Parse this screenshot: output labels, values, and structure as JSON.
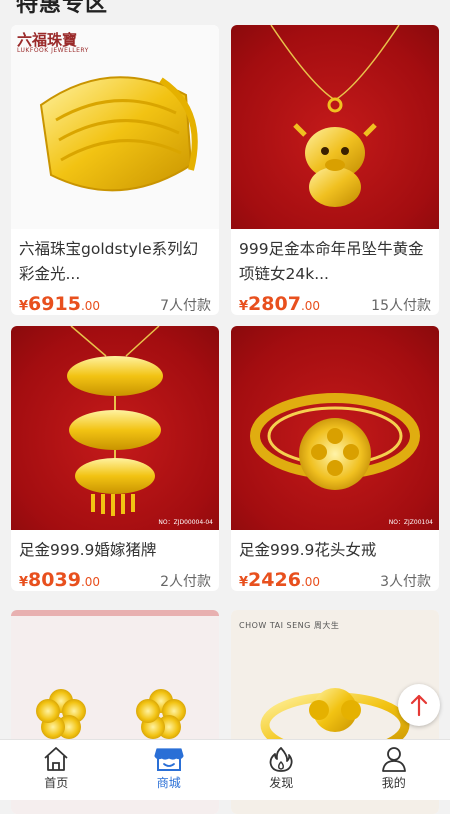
{
  "section": {
    "title": "特惠专区"
  },
  "products": [
    {
      "title": "六福珠宝goldstyle系列幻彩金光...",
      "currency": "¥",
      "price_int": "6915",
      "price_dec": ".00",
      "sold": "7人付款",
      "brand": "六福珠寶",
      "brand_sub": "LUKFOOK JEWELLERY"
    },
    {
      "title": "999足金本命年吊坠牛黄金项链女24k...",
      "currency": "¥",
      "price_int": "2807",
      "price_dec": ".00",
      "sold": "15人付款"
    },
    {
      "title": "足金999.9婚嫁猪牌",
      "currency": "¥",
      "price_int": "8039",
      "price_dec": ".00",
      "sold": "2人付款",
      "code": "NO：ZJD00004-04"
    },
    {
      "title": "足金999.9花头女戒",
      "currency": "¥",
      "price_int": "2426",
      "price_dec": ".00",
      "sold": "3人付款",
      "code": "NO：ZJZ00104"
    },
    {
      "title": "",
      "brand": ""
    },
    {
      "title": "",
      "brand": "CHOW TAI SENG 周大生"
    }
  ],
  "tabbar": {
    "items": [
      {
        "label": "首页",
        "icon": "home-icon"
      },
      {
        "label": "商城",
        "icon": "shop-icon",
        "active": true
      },
      {
        "label": "发现",
        "icon": "flame-icon"
      },
      {
        "label": "我的",
        "icon": "user-icon"
      }
    ]
  },
  "colors": {
    "price": "#e8501e",
    "active_tab": "#2a6fd6",
    "background": "#f2f2f2"
  }
}
